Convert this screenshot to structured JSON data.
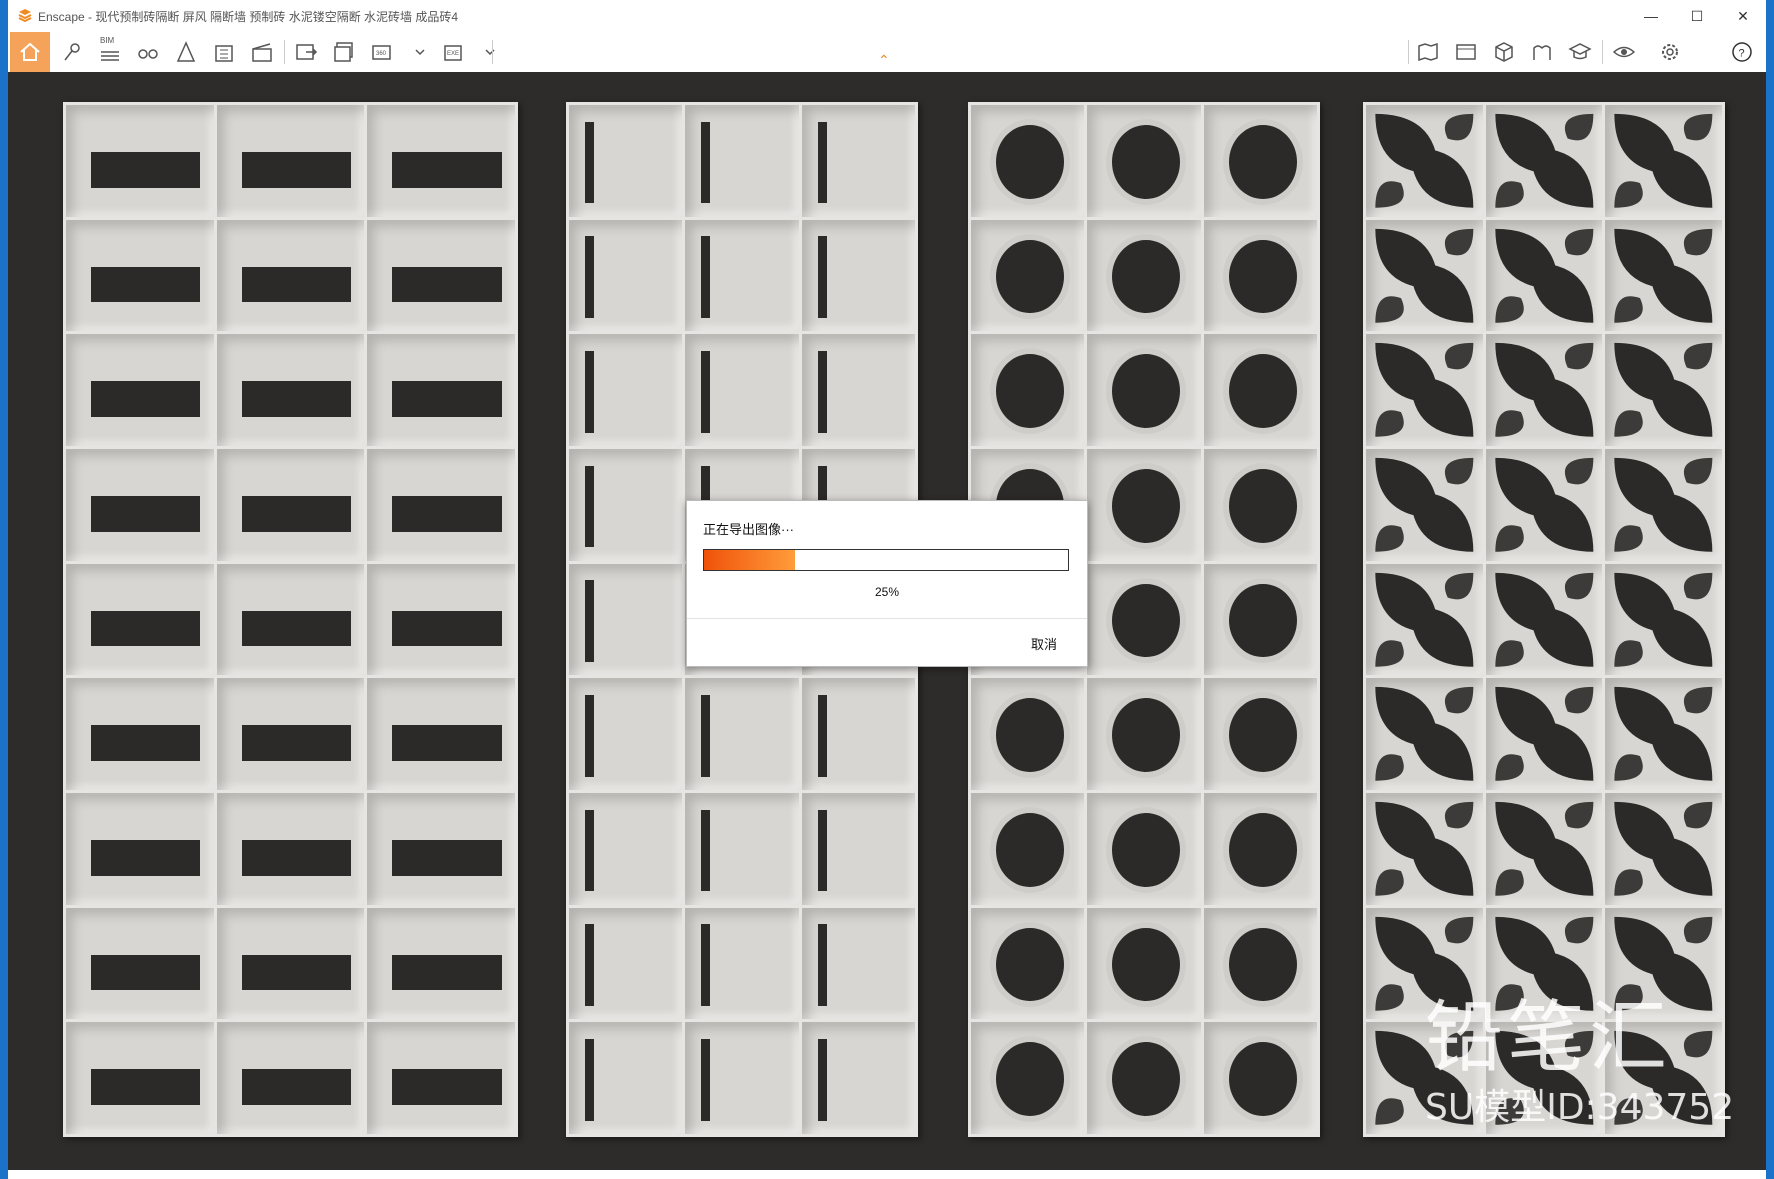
{
  "window": {
    "title": "Enscape - 现代预制砖隔断 屏风 隔断墙 预制砖 水泥镂空隔断 水泥砖墙 成品砖4"
  },
  "toolbar": {
    "bim_label": "BIM",
    "icons": [
      "home-icon",
      "pin-icon",
      "bim-icon",
      "binoculars-icon",
      "light-icon",
      "building-icon",
      "clapper-icon",
      "export-image-icon",
      "batch-export-icon",
      "export-360-icon",
      "export-exe-icon",
      "map-icon",
      "panel-icon",
      "cube-icon",
      "asset-icon",
      "graduate-icon",
      "eye-icon",
      "settings-icon",
      "help-icon"
    ],
    "accent_color": "#f5a25a"
  },
  "viewport": {
    "background": "#2e2c2a",
    "panels": [
      "slot-blocks",
      "slit-blocks",
      "circle-blocks",
      "leaf-blocks"
    ]
  },
  "dialog": {
    "title": "正在导出图像···",
    "progress": 0.25,
    "progress_text": "25%",
    "cancel_label": "取消"
  },
  "watermark": {
    "brand": "铅笔汇",
    "model_id": "SU模型ID:343752"
  }
}
